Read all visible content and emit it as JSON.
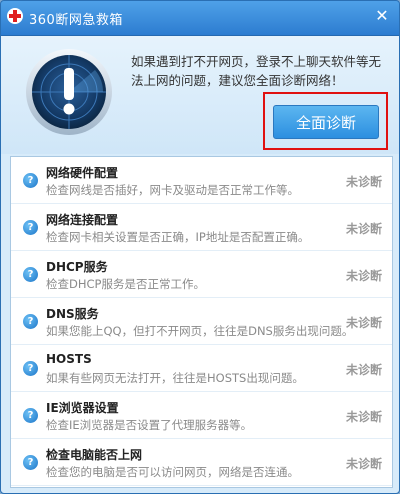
{
  "window": {
    "title": "360断网急救箱",
    "close_symbol": "✕"
  },
  "header": {
    "message": "如果遇到打不开网页，登录不上聊天软件等无法上网的问题，建议您全面诊断网络！",
    "diagnose_button": "全面诊断"
  },
  "items": [
    {
      "title": "网络硬件配置",
      "desc": "检查网线是否插好，网卡及驱动是否正常工作等。",
      "status": "未诊断"
    },
    {
      "title": "网络连接配置",
      "desc": "检查网卡相关设置是否正确，IP地址是否配置正确。",
      "status": "未诊断"
    },
    {
      "title": "DHCP服务",
      "desc": "检查DHCP服务是否正常工作。",
      "status": "未诊断"
    },
    {
      "title": "DNS服务",
      "desc": "如果您能上QQ，但打不开网页，往往是DNS服务出现问题。",
      "status": "未诊断"
    },
    {
      "title": "HOSTS",
      "desc": "如果有些网页无法打开，往往是HOSTS出现问题。",
      "status": "未诊断"
    },
    {
      "title": "IE浏览器设置",
      "desc": "检查IE浏览器是否设置了代理服务器等。",
      "status": "未诊断"
    },
    {
      "title": "检查电脑能否上网",
      "desc": "检查您的电脑是否可以访问网页，网络是否连通。",
      "status": "未诊断"
    }
  ],
  "icons": {
    "title_logo": "red-cross-icon",
    "alert": "exclamation-radar-icon",
    "row": "question-icon"
  },
  "colors": {
    "titlebar": "#2c7cd0",
    "button": "#2c8fe0",
    "highlight_outline": "#e01010",
    "status_text": "#999999"
  }
}
